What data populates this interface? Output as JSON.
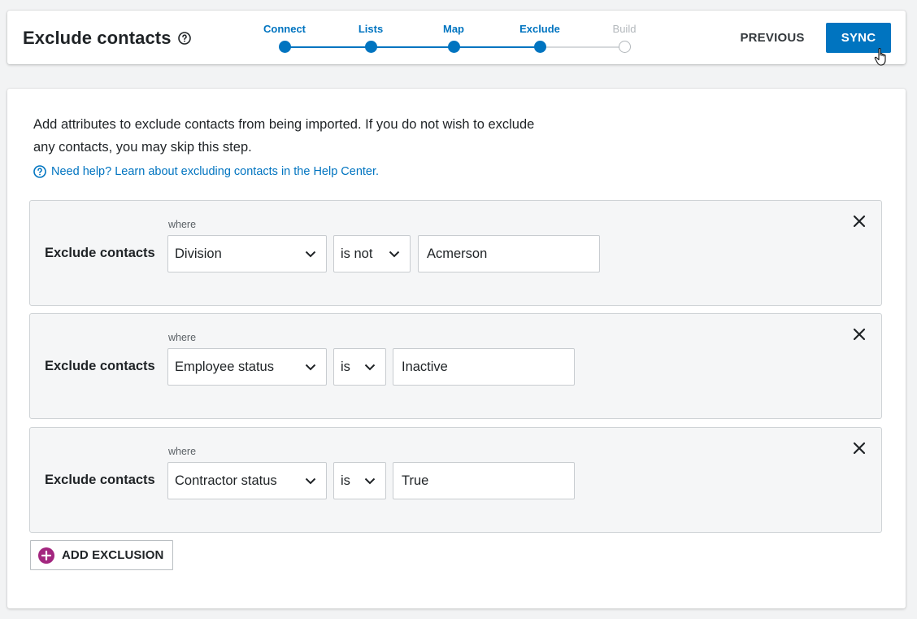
{
  "header": {
    "title": "Exclude contacts",
    "steps": [
      {
        "label": "Connect",
        "state": "complete"
      },
      {
        "label": "Lists",
        "state": "complete"
      },
      {
        "label": "Map",
        "state": "complete"
      },
      {
        "label": "Exclude",
        "state": "current"
      },
      {
        "label": "Build",
        "state": "incomplete"
      }
    ],
    "previous_label": "PREVIOUS",
    "sync_label": "SYNC"
  },
  "main": {
    "intro_line1": "Add attributes to exclude contacts from being imported. If you do not wish to exclude",
    "intro_line2": "any contacts, you may skip this step.",
    "help_link": "Need help? Learn about excluding contacts in the Help Center.",
    "rules": [
      {
        "label": "Exclude contacts",
        "where": "where",
        "attribute": "Division",
        "operator": "is not",
        "value": "Acmerson"
      },
      {
        "label": "Exclude contacts",
        "where": "where",
        "attribute": "Employee status",
        "operator": "is",
        "value": "Inactive"
      },
      {
        "label": "Exclude contacts",
        "where": "where",
        "attribute": "Contractor status",
        "operator": "is",
        "value": "True"
      }
    ],
    "add_label": "ADD EXCLUSION"
  },
  "colors": {
    "accent": "#0074c0",
    "add_icon": "#a3267f",
    "inactive_step": "#b3b8bc"
  }
}
